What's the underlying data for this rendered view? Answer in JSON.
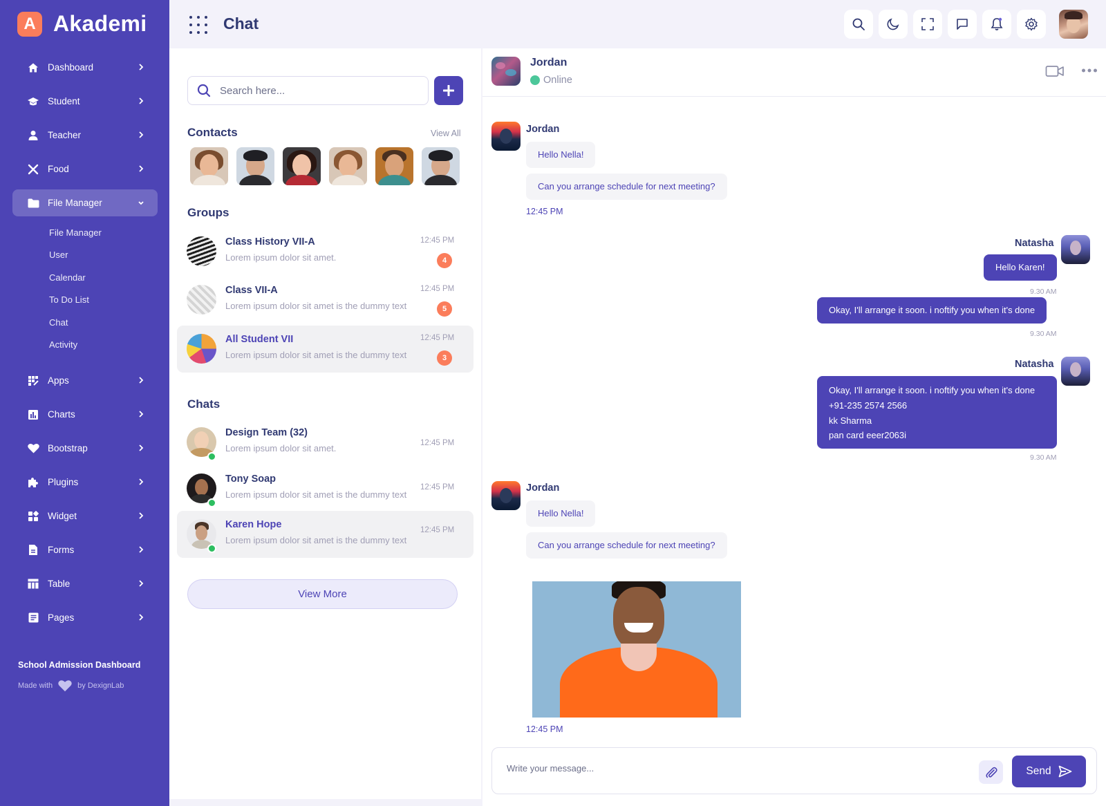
{
  "brand": {
    "logo_letter": "A",
    "name": "Akademi"
  },
  "sidebar": {
    "items": [
      {
        "label": "Dashboard",
        "icon": "home-icon"
      },
      {
        "label": "Student",
        "icon": "graduation-cap-icon"
      },
      {
        "label": "Teacher",
        "icon": "user-icon"
      },
      {
        "label": "Food",
        "icon": "utensils-icon"
      },
      {
        "label": "File Manager",
        "icon": "folder-icon",
        "active": true
      },
      {
        "label": "Apps",
        "icon": "apps-icon"
      },
      {
        "label": "Charts",
        "icon": "chart-icon"
      },
      {
        "label": "Bootstrap",
        "icon": "heart-icon"
      },
      {
        "label": "Plugins",
        "icon": "puzzle-icon"
      },
      {
        "label": "Widget",
        "icon": "widget-icon"
      },
      {
        "label": "Forms",
        "icon": "file-icon"
      },
      {
        "label": "Table",
        "icon": "table-icon"
      },
      {
        "label": "Pages",
        "icon": "pages-icon"
      }
    ],
    "subitems": [
      "File Manager",
      "User",
      "Calendar",
      "To Do List",
      "Chat",
      "Activity"
    ],
    "footer_title": "School Admission Dashboard",
    "footer_made": "Made with",
    "footer_by": "by DexignLab"
  },
  "header": {
    "title": "Chat"
  },
  "list": {
    "search_placeholder": "Search here...",
    "contacts_title": "Contacts",
    "view_all": "View All",
    "groups_title": "Groups",
    "groups": [
      {
        "name": "Class History VII-A",
        "msg": "Lorem ipsum dolor sit amet.",
        "time": "12:45 PM",
        "badge": "4"
      },
      {
        "name": "Class VII-A",
        "msg": "Lorem ipsum dolor sit amet is the dummy text",
        "time": "12:45 PM",
        "badge": "5"
      },
      {
        "name": "All Student VII",
        "msg": "Lorem ipsum dolor sit amet is the dummy text",
        "time": "12:45 PM",
        "badge": "3"
      }
    ],
    "chats_title": "Chats",
    "chats": [
      {
        "name": "Design Team (32)",
        "msg": "Lorem ipsum dolor sit amet.",
        "time": "12:45 PM"
      },
      {
        "name": "Tony Soap",
        "msg": "Lorem ipsum dolor sit amet is the dummy text",
        "time": "12:45 PM"
      },
      {
        "name": "Karen Hope",
        "msg": "Lorem ipsum dolor sit amet is the dummy text",
        "time": "12:45 PM"
      }
    ],
    "view_more": "View More"
  },
  "chat": {
    "contact_name": "Jordan",
    "status": "Online",
    "messages": [
      {
        "sender": "Jordan",
        "lines": [
          "Hello Nella!",
          "Can you arrange schedule for next meeting?"
        ],
        "time": "12:45 PM"
      },
      {
        "sender": "Natasha",
        "lines": [
          "Hello Karen!"
        ],
        "time": "9.30 AM"
      },
      {
        "lines": [
          "Okay, I'll arrange it soon. i noftify you when it's done"
        ],
        "time": "9.30 AM"
      },
      {
        "sender": "Natasha",
        "lines": [
          "Okay, I'll arrange it soon. i noftify you when it's done",
          "+91-235 2574 2566",
          "kk Sharma",
          "pan card eeer2063i"
        ],
        "time": "9.30 AM"
      },
      {
        "sender": "Jordan",
        "lines": [
          "Hello Nella!",
          "Can you arrange schedule for next meeting?"
        ],
        "time": "12:45 PM"
      }
    ],
    "composer_placeholder": "Write your message...",
    "send_label": "Send"
  },
  "colors": {
    "primary": "#4D44B5",
    "accent": "#FB7D5B",
    "online": "#2DBE60",
    "text": "#303972"
  }
}
